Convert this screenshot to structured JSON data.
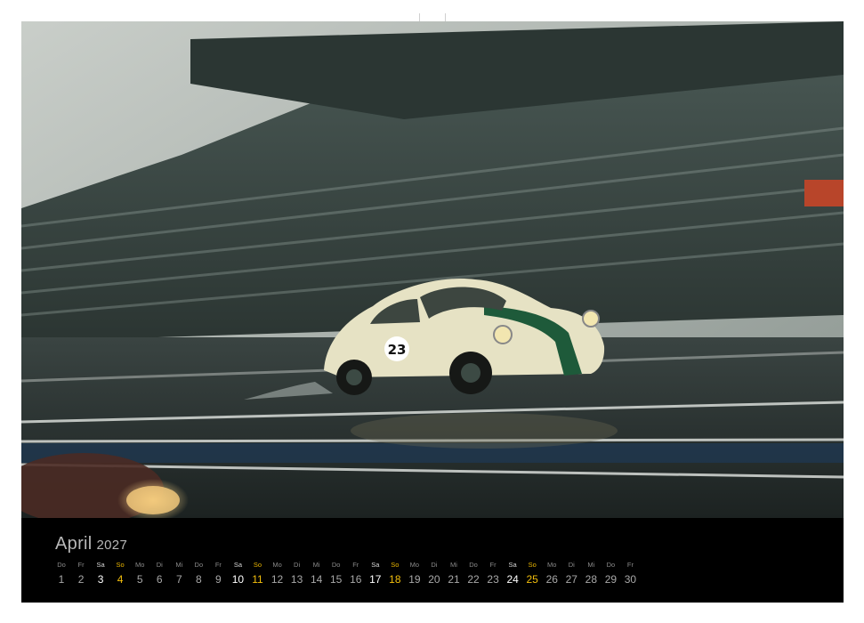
{
  "calendar": {
    "month": "April",
    "year": "2027",
    "days": [
      {
        "wd": "Do",
        "n": "1",
        "type": "weekday"
      },
      {
        "wd": "Fr",
        "n": "2",
        "type": "weekday"
      },
      {
        "wd": "Sa",
        "n": "3",
        "type": "sat"
      },
      {
        "wd": "So",
        "n": "4",
        "type": "sun"
      },
      {
        "wd": "Mo",
        "n": "5",
        "type": "weekday"
      },
      {
        "wd": "Di",
        "n": "6",
        "type": "weekday"
      },
      {
        "wd": "Mi",
        "n": "7",
        "type": "weekday"
      },
      {
        "wd": "Do",
        "n": "8",
        "type": "weekday"
      },
      {
        "wd": "Fr",
        "n": "9",
        "type": "weekday"
      },
      {
        "wd": "Sa",
        "n": "10",
        "type": "sat"
      },
      {
        "wd": "So",
        "n": "11",
        "type": "sun"
      },
      {
        "wd": "Mo",
        "n": "12",
        "type": "weekday"
      },
      {
        "wd": "Di",
        "n": "13",
        "type": "weekday"
      },
      {
        "wd": "Mi",
        "n": "14",
        "type": "weekday"
      },
      {
        "wd": "Do",
        "n": "15",
        "type": "weekday"
      },
      {
        "wd": "Fr",
        "n": "16",
        "type": "weekday"
      },
      {
        "wd": "Sa",
        "n": "17",
        "type": "sat"
      },
      {
        "wd": "So",
        "n": "18",
        "type": "sun"
      },
      {
        "wd": "Mo",
        "n": "19",
        "type": "weekday"
      },
      {
        "wd": "Di",
        "n": "20",
        "type": "weekday"
      },
      {
        "wd": "Mi",
        "n": "21",
        "type": "weekday"
      },
      {
        "wd": "Do",
        "n": "22",
        "type": "weekday"
      },
      {
        "wd": "Fr",
        "n": "23",
        "type": "weekday"
      },
      {
        "wd": "Sa",
        "n": "24",
        "type": "sat"
      },
      {
        "wd": "So",
        "n": "25",
        "type": "sun"
      },
      {
        "wd": "Mo",
        "n": "26",
        "type": "weekday"
      },
      {
        "wd": "Di",
        "n": "27",
        "type": "weekday"
      },
      {
        "wd": "Mi",
        "n": "28",
        "type": "weekday"
      },
      {
        "wd": "Do",
        "n": "29",
        "type": "weekday"
      },
      {
        "wd": "Fr",
        "n": "30",
        "type": "weekday"
      }
    ]
  },
  "photo": {
    "car_number": "23",
    "car_color": "#e6e2c4",
    "stripe_color": "#1e5a3a"
  },
  "colors": {
    "sunday": "#f2be0c",
    "saturday": "#ffffff",
    "weekday": "#a8a8a8"
  }
}
